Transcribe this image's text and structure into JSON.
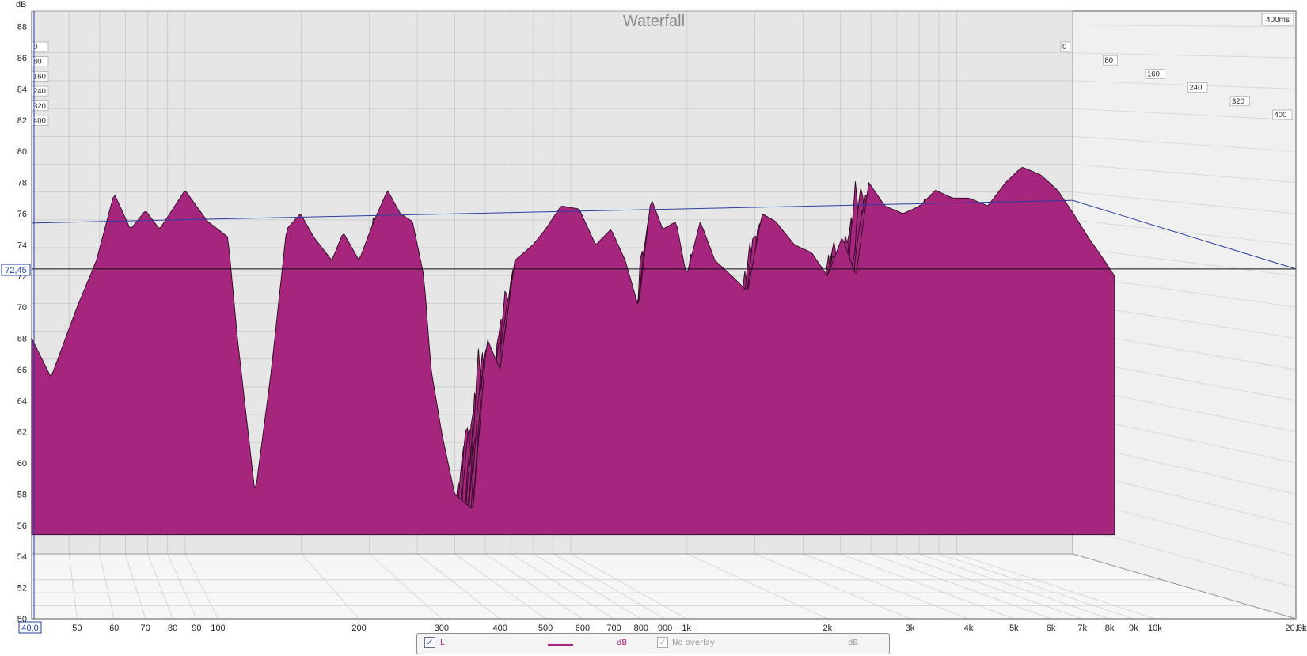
{
  "chart_data": {
    "type": "area",
    "title": "Waterfall",
    "y_unit": "dB",
    "x_unit": "Hz",
    "y_range": [
      50,
      89
    ],
    "y_ticks": [
      "50",
      "52",
      "54",
      "56",
      "58",
      "60",
      "62",
      "64",
      "66",
      "68",
      "70",
      "72",
      "74",
      "76",
      "78",
      "80",
      "82",
      "84",
      "86",
      "88"
    ],
    "x_range": [
      40,
      20000
    ],
    "x_scale": "log",
    "x_ticks": [
      {
        "v": 40,
        "label": "40,0"
      },
      {
        "v": 50,
        "label": "50"
      },
      {
        "v": 60,
        "label": "60"
      },
      {
        "v": 70,
        "label": "70"
      },
      {
        "v": 80,
        "label": "80"
      },
      {
        "v": 90,
        "label": "90"
      },
      {
        "v": 100,
        "label": "100"
      },
      {
        "v": 200,
        "label": "200"
      },
      {
        "v": 300,
        "label": "300"
      },
      {
        "v": 400,
        "label": "400"
      },
      {
        "v": 500,
        "label": "500"
      },
      {
        "v": 600,
        "label": "600"
      },
      {
        "v": 700,
        "label": "700"
      },
      {
        "v": 800,
        "label": "800"
      },
      {
        "v": 900,
        "label": "900"
      },
      {
        "v": 1000,
        "label": "1k"
      },
      {
        "v": 2000,
        "label": "2k"
      },
      {
        "v": 3000,
        "label": "3k"
      },
      {
        "v": 4000,
        "label": "4k"
      },
      {
        "v": 5000,
        "label": "5k"
      },
      {
        "v": 6000,
        "label": "6k"
      },
      {
        "v": 7000,
        "label": "7k"
      },
      {
        "v": 8000,
        "label": "8k"
      },
      {
        "v": 9000,
        "label": "9k"
      },
      {
        "v": 10000,
        "label": "10k"
      },
      {
        "v": 20000,
        "label": "20,0k"
      }
    ],
    "time_ticks_ms": [
      "0",
      "80",
      "160",
      "240",
      "320",
      "400"
    ],
    "time_range_label": "400ms",
    "cursor_db": "72,45",
    "cursor_hz": "40,0",
    "fill_color": "#a6267e",
    "series": [
      {
        "name": "L",
        "time_ms": 0,
        "points": [
          [
            40,
            68
          ],
          [
            44,
            65.5
          ],
          [
            50,
            70
          ],
          [
            55,
            73
          ],
          [
            60,
            77.3
          ],
          [
            65,
            75
          ],
          [
            70,
            76.2
          ],
          [
            75,
            75
          ],
          [
            85,
            77.5
          ],
          [
            95,
            75.5
          ],
          [
            105,
            74.5
          ],
          [
            110,
            68
          ],
          [
            120,
            58
          ],
          [
            130,
            66
          ],
          [
            140,
            75
          ],
          [
            150,
            76
          ],
          [
            160,
            74.5
          ],
          [
            175,
            73
          ],
          [
            185,
            74.8
          ],
          [
            200,
            73
          ],
          [
            215,
            75.5
          ],
          [
            230,
            77.5
          ],
          [
            245,
            76
          ],
          [
            260,
            75.5
          ],
          [
            275,
            72
          ],
          [
            285,
            66
          ],
          [
            300,
            62
          ],
          [
            320,
            58
          ],
          [
            350,
            57
          ],
          [
            375,
            68
          ],
          [
            400,
            66
          ],
          [
            430,
            73
          ],
          [
            470,
            74
          ],
          [
            500,
            75
          ],
          [
            540,
            76.5
          ],
          [
            590,
            76.3
          ],
          [
            640,
            74
          ],
          [
            690,
            75
          ],
          [
            740,
            73
          ],
          [
            790,
            70
          ],
          [
            840,
            77
          ],
          [
            890,
            75
          ],
          [
            950,
            75.5
          ],
          [
            1000,
            72
          ],
          [
            1070,
            75.5
          ],
          [
            1150,
            73
          ],
          [
            1250,
            72
          ],
          [
            1350,
            71
          ],
          [
            1450,
            76
          ],
          [
            1550,
            75.5
          ],
          [
            1700,
            74
          ],
          [
            1850,
            73.5
          ],
          [
            2000,
            72
          ],
          [
            2150,
            74.5
          ],
          [
            2300,
            72
          ],
          [
            2450,
            78
          ],
          [
            2650,
            76.5
          ],
          [
            2900,
            76
          ],
          [
            3150,
            76.5
          ],
          [
            3400,
            77.5
          ],
          [
            3700,
            77
          ],
          [
            4000,
            77
          ],
          [
            4400,
            76.5
          ],
          [
            4800,
            78
          ],
          [
            5200,
            79
          ],
          [
            5700,
            78.5
          ],
          [
            6200,
            77.5
          ],
          [
            6700,
            76
          ],
          [
            7200,
            74.5
          ],
          [
            7800,
            73
          ],
          [
            8200,
            72
          ]
        ]
      }
    ]
  },
  "legend": {
    "ch1_check": "✓",
    "ch1_label": "L",
    "ch1_unit": "dB",
    "ch2_check": "✓",
    "ch2_label": "No overlay",
    "ch2_unit": "dB"
  }
}
